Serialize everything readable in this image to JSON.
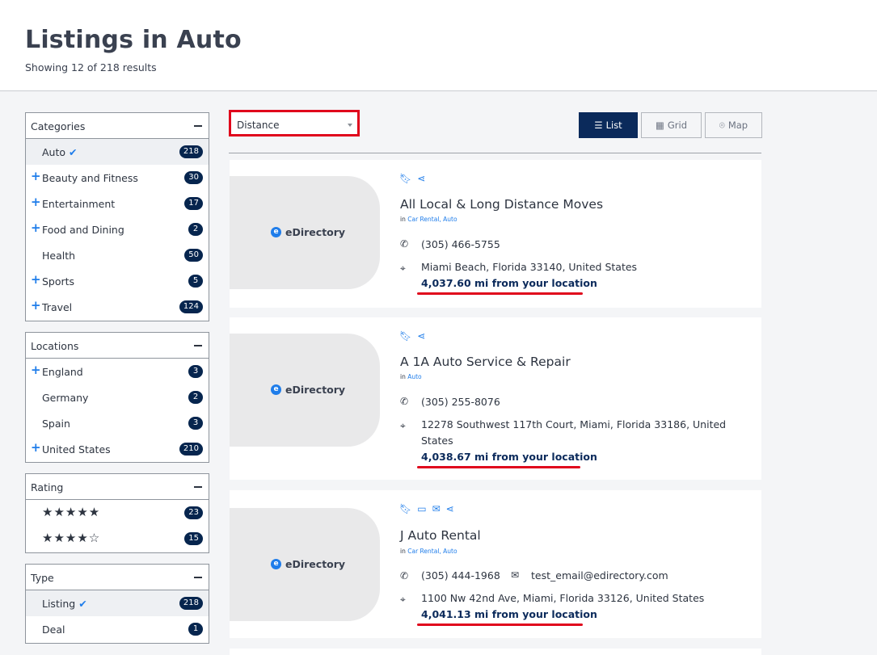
{
  "header": {
    "title": "Listings in Auto",
    "results": "Showing 12 of 218 results"
  },
  "sidebar": {
    "categories": {
      "title": "Categories",
      "items": [
        {
          "label": "Auto",
          "count": "218",
          "active": true,
          "checked": true,
          "expand": false
        },
        {
          "label": "Beauty and Fitness",
          "count": "30",
          "expand": true
        },
        {
          "label": "Entertainment",
          "count": "17",
          "expand": true
        },
        {
          "label": "Food and Dining",
          "count": "2",
          "expand": true
        },
        {
          "label": "Health",
          "count": "50",
          "expand": false
        },
        {
          "label": "Sports",
          "count": "5",
          "expand": true
        },
        {
          "label": "Travel",
          "count": "124",
          "expand": true
        }
      ]
    },
    "locations": {
      "title": "Locations",
      "items": [
        {
          "label": "England",
          "count": "3",
          "expand": true
        },
        {
          "label": "Germany",
          "count": "2",
          "expand": false
        },
        {
          "label": "Spain",
          "count": "3",
          "expand": false
        },
        {
          "label": "United States",
          "count": "210",
          "expand": true
        }
      ]
    },
    "rating": {
      "title": "Rating",
      "items": [
        {
          "stars": "★★★★★",
          "count": "23"
        },
        {
          "stars": "★★★★☆",
          "count": "15"
        }
      ]
    },
    "type": {
      "title": "Type",
      "items": [
        {
          "label": "Listing",
          "count": "218",
          "active": true,
          "checked": true
        },
        {
          "label": "Deal",
          "count": "1"
        }
      ]
    }
  },
  "toolbar": {
    "sort_value": "Distance",
    "views": {
      "list": "List",
      "grid": "Grid",
      "map": "Map"
    }
  },
  "brand": "eDirectory",
  "listings": [
    {
      "title": "All Local & Long Distance Moves",
      "in_label": "in",
      "categories": "Car Rental, Auto",
      "phone": "(305) 466-5755",
      "address": "Miami Beach, Florida 33140, United States",
      "distance": "4,037.60 mi from your location"
    },
    {
      "title": "A 1A Auto Service & Repair",
      "in_label": "in",
      "categories": "Auto",
      "phone": "(305) 255-8076",
      "address": "12278 Southwest 117th Court, Miami, Florida 33186, United States",
      "distance": "4,038.67 mi from your location"
    },
    {
      "title": "J Auto Rental",
      "in_label": "in",
      "categories": "Car Rental, Auto",
      "phone": "(305) 444-1968",
      "email": "test_email@edirectory.com",
      "address": "1100 Nw 42nd Ave, Miami, Florida 33126, United States",
      "distance": "4,041.13 mi from your location"
    }
  ],
  "colors": {
    "accent": "#1f7dea",
    "badge": "#06254e",
    "highlight": "#e0061c",
    "active_button": "#0b2a5b"
  }
}
